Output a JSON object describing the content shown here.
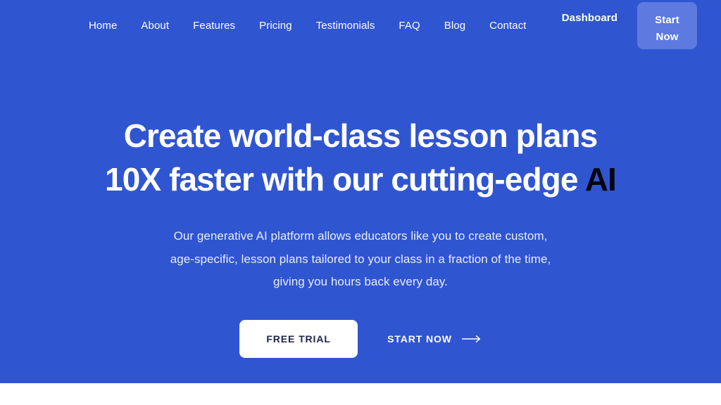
{
  "colors": {
    "hero_background": "#3055d1",
    "start_now_button": "#5c7ae0",
    "headline_text": "#ffffff",
    "headline_accent": "#05050f",
    "free_trial_background": "#ffffff",
    "free_trial_text": "#1e2448",
    "subheadline_text": "#e8ecfb",
    "below_fold_background": "#ffffff"
  },
  "navbar": {
    "links": [
      {
        "label": "Home"
      },
      {
        "label": "About"
      },
      {
        "label": "Features"
      },
      {
        "label": "Pricing"
      },
      {
        "label": "Testimonials"
      },
      {
        "label": "FAQ"
      },
      {
        "label": "Blog"
      },
      {
        "label": "Contact"
      }
    ],
    "dashboard_label": "Dashboard",
    "start_now_label": "Start Now"
  },
  "hero": {
    "headline_line1": "Create world-class lesson plans",
    "headline_line2_main": "10X faster with our cutting-edge ",
    "headline_line2_accent": "AI",
    "subheadline": "Our generative AI platform allows educators like you to create custom, age-specific, lesson plans tailored to your class in a fraction of the time, giving you hours back every day.",
    "cta_primary_label": "FREE TRIAL",
    "cta_secondary_label": "START NOW",
    "cta_secondary_icon": "arrow-right-icon"
  }
}
